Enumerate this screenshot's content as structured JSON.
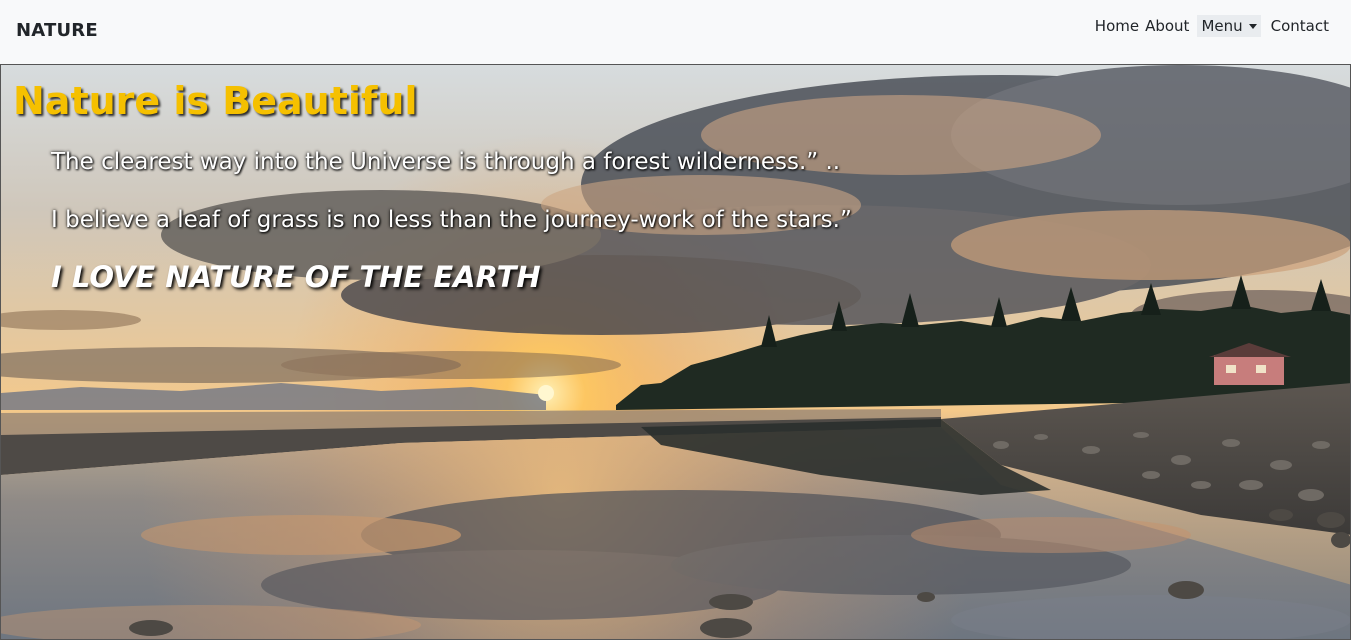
{
  "navbar": {
    "brand": "NATURE",
    "links": {
      "home": "Home",
      "about": "About",
      "menu": "Menu",
      "contact": "Contact"
    }
  },
  "hero": {
    "title": "Nature is Beautiful",
    "quote_1": "The clearest way into the Universe is through a forest wilderness.” ..",
    "quote_2": "I believe a leaf of grass is no less than the journey-work of the stars.”",
    "slogan": "I LOVE NATURE OF THE EARTH",
    "image": "sunset-beach-reflection-landscape"
  },
  "colors": {
    "navbar_bg": "#f8f9fa",
    "title": "#f5c000",
    "text": "#ffffff"
  }
}
